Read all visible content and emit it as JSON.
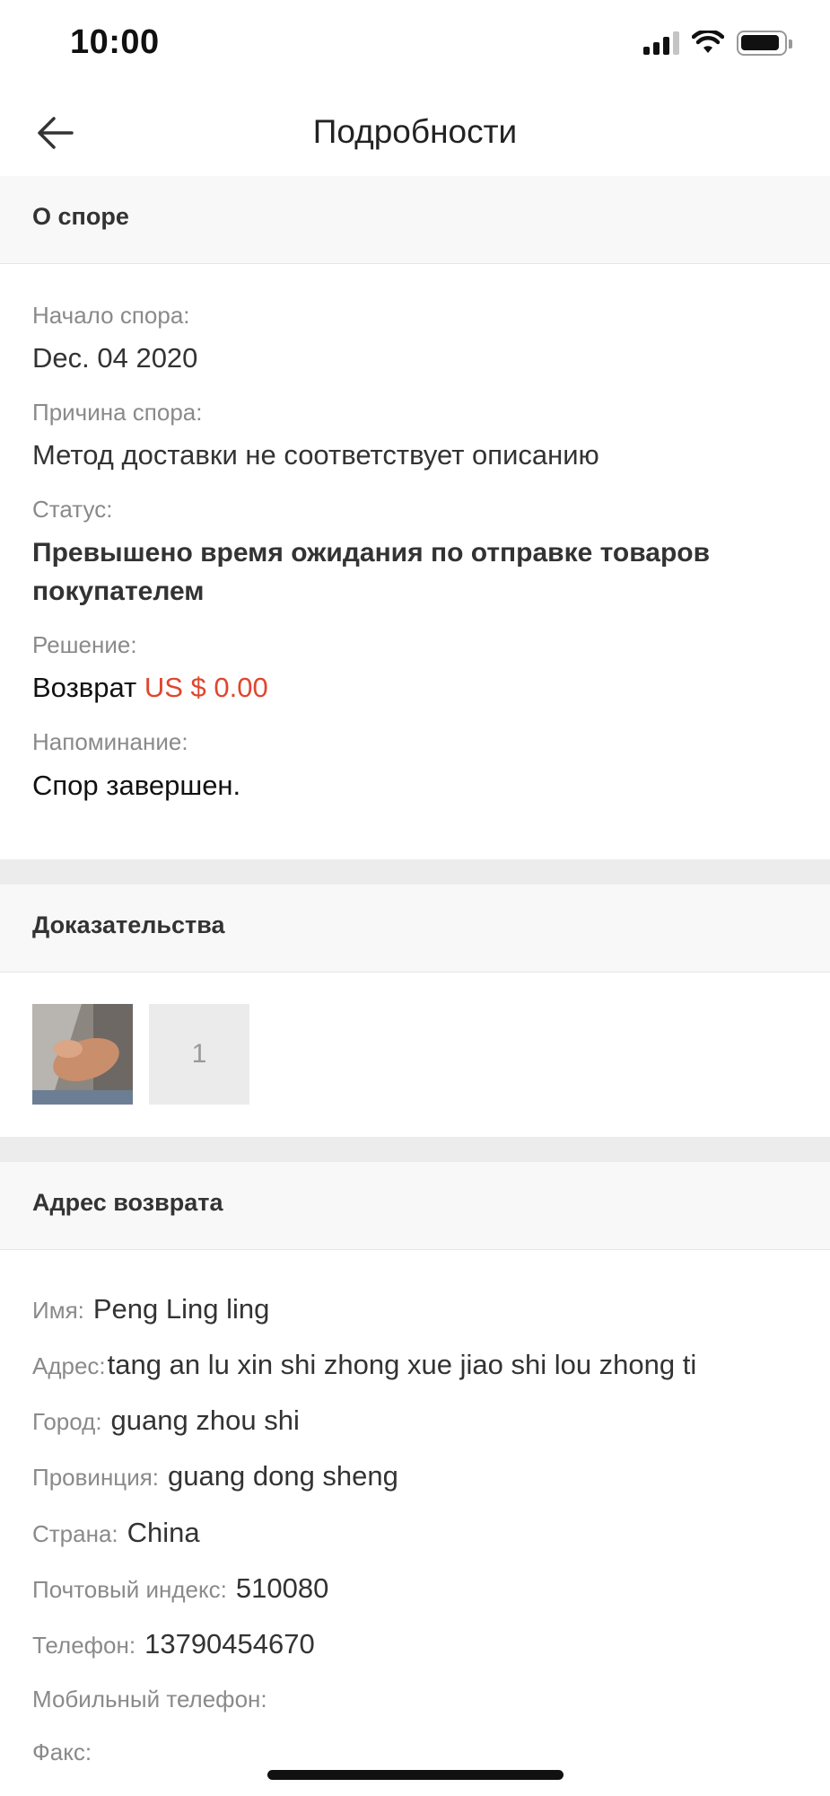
{
  "status_bar": {
    "time": "10:00"
  },
  "nav": {
    "title": "Подробности"
  },
  "dispute": {
    "section_title": "О споре",
    "start_label": "Начало спора:",
    "start_value": "Dec. 04 2020",
    "reason_label": "Причина спора:",
    "reason_value": "Метод доставки не соответствует описанию",
    "status_label": "Статус:",
    "status_value": "Превышено время ожидания по отправке товаров покупателем",
    "resolution_label": "Решение:",
    "resolution_prefix": "Возврат",
    "resolution_amount": "US $ 0.00",
    "reminder_label": "Напоминание:",
    "reminder_value": "Спор завершен."
  },
  "evidence": {
    "section_title": "Доказательства",
    "more_count": "1"
  },
  "return_address": {
    "section_title": "Адрес возврата",
    "name_label": "Имя:",
    "name_value": "Peng Ling ling",
    "address_label": "Адрес:",
    "address_value": "tang an lu xin shi zhong xue jiao shi lou zhong ti",
    "city_label": "Город:",
    "city_value": "guang zhou shi",
    "province_label": "Провинция:",
    "province_value": "guang dong sheng",
    "country_label": "Страна:",
    "country_value": "China",
    "zip_label": "Почтовый индекс:",
    "zip_value": "510080",
    "phone_label": "Телефон:",
    "phone_value": "13790454670",
    "mobile_label": "Мобильный телефон:",
    "fax_label": "Факс:"
  },
  "colors": {
    "accent_red": "#e0462f"
  }
}
